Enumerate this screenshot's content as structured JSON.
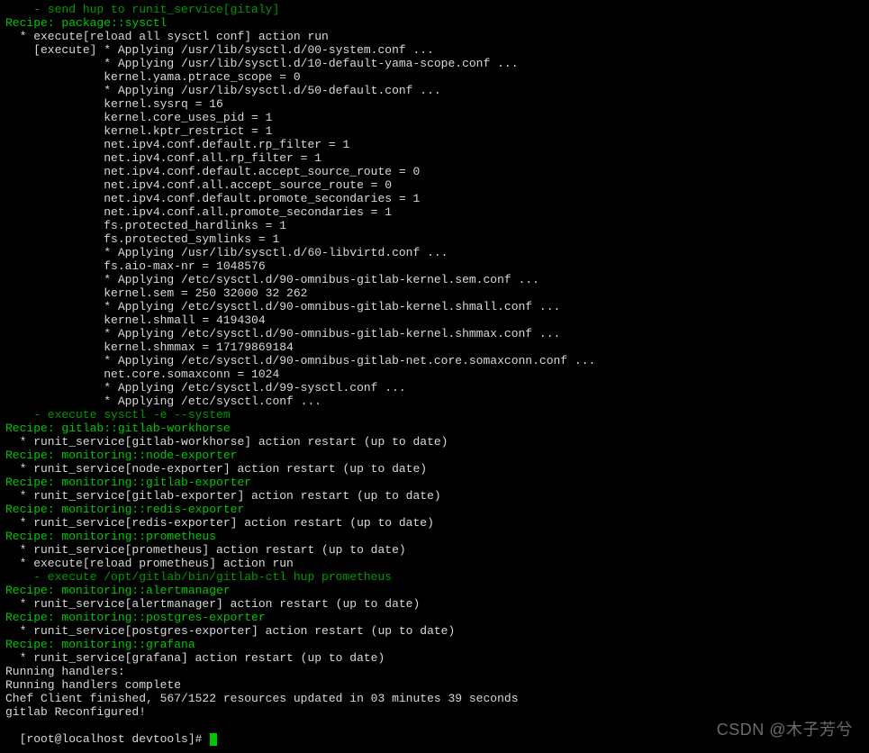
{
  "lines": [
    {
      "cls": "dimgreen",
      "text": "    - send hup to runit_service[gitaly]"
    },
    {
      "cls": "green",
      "text": "Recipe: package::sysctl"
    },
    {
      "cls": "",
      "text": "  * execute[reload all sysctl conf] action run"
    },
    {
      "cls": "",
      "text": "    [execute] * Applying /usr/lib/sysctl.d/00-system.conf ..."
    },
    {
      "cls": "",
      "text": "              * Applying /usr/lib/sysctl.d/10-default-yama-scope.conf ..."
    },
    {
      "cls": "",
      "text": "              kernel.yama.ptrace_scope = 0"
    },
    {
      "cls": "",
      "text": "              * Applying /usr/lib/sysctl.d/50-default.conf ..."
    },
    {
      "cls": "",
      "text": "              kernel.sysrq = 16"
    },
    {
      "cls": "",
      "text": "              kernel.core_uses_pid = 1"
    },
    {
      "cls": "",
      "text": "              kernel.kptr_restrict = 1"
    },
    {
      "cls": "",
      "text": "              net.ipv4.conf.default.rp_filter = 1"
    },
    {
      "cls": "",
      "text": "              net.ipv4.conf.all.rp_filter = 1"
    },
    {
      "cls": "",
      "text": "              net.ipv4.conf.default.accept_source_route = 0"
    },
    {
      "cls": "",
      "text": "              net.ipv4.conf.all.accept_source_route = 0"
    },
    {
      "cls": "",
      "text": "              net.ipv4.conf.default.promote_secondaries = 1"
    },
    {
      "cls": "",
      "text": "              net.ipv4.conf.all.promote_secondaries = 1"
    },
    {
      "cls": "",
      "text": "              fs.protected_hardlinks = 1"
    },
    {
      "cls": "",
      "text": "              fs.protected_symlinks = 1"
    },
    {
      "cls": "",
      "text": "              * Applying /usr/lib/sysctl.d/60-libvirtd.conf ..."
    },
    {
      "cls": "",
      "text": "              fs.aio-max-nr = 1048576"
    },
    {
      "cls": "",
      "text": "              * Applying /etc/sysctl.d/90-omnibus-gitlab-kernel.sem.conf ..."
    },
    {
      "cls": "",
      "text": "              kernel.sem = 250 32000 32 262"
    },
    {
      "cls": "",
      "text": "              * Applying /etc/sysctl.d/90-omnibus-gitlab-kernel.shmall.conf ..."
    },
    {
      "cls": "",
      "text": "              kernel.shmall = 4194304"
    },
    {
      "cls": "",
      "text": "              * Applying /etc/sysctl.d/90-omnibus-gitlab-kernel.shmmax.conf ..."
    },
    {
      "cls": "",
      "text": "              kernel.shmmax = 17179869184"
    },
    {
      "cls": "",
      "text": "              * Applying /etc/sysctl.d/90-omnibus-gitlab-net.core.somaxconn.conf ..."
    },
    {
      "cls": "",
      "text": "              net.core.somaxconn = 1024"
    },
    {
      "cls": "",
      "text": "              * Applying /etc/sysctl.d/99-sysctl.conf ..."
    },
    {
      "cls": "",
      "text": "              * Applying /etc/sysctl.conf ..."
    },
    {
      "cls": "dimgreen",
      "text": "    - execute sysctl -e --system"
    },
    {
      "cls": "green",
      "text": "Recipe: gitlab::gitlab-workhorse"
    },
    {
      "cls": "",
      "text": "  * runit_service[gitlab-workhorse] action restart (up to date)"
    },
    {
      "cls": "green",
      "text": "Recipe: monitoring::node-exporter"
    },
    {
      "cls": "",
      "text": "  * runit_service[node-exporter] action restart (up to date)"
    },
    {
      "cls": "green",
      "text": "Recipe: monitoring::gitlab-exporter"
    },
    {
      "cls": "",
      "text": "  * runit_service[gitlab-exporter] action restart (up to date)"
    },
    {
      "cls": "green",
      "text": "Recipe: monitoring::redis-exporter"
    },
    {
      "cls": "",
      "text": "  * runit_service[redis-exporter] action restart (up to date)"
    },
    {
      "cls": "green",
      "text": "Recipe: monitoring::prometheus"
    },
    {
      "cls": "",
      "text": "  * runit_service[prometheus] action restart (up to date)"
    },
    {
      "cls": "",
      "text": "  * execute[reload prometheus] action run"
    },
    {
      "cls": "dimgreen",
      "text": "    - execute /opt/gitlab/bin/gitlab-ctl hup prometheus"
    },
    {
      "cls": "green",
      "text": "Recipe: monitoring::alertmanager"
    },
    {
      "cls": "",
      "text": "  * runit_service[alertmanager] action restart (up to date)"
    },
    {
      "cls": "green",
      "text": "Recipe: monitoring::postgres-exporter"
    },
    {
      "cls": "",
      "text": "  * runit_service[postgres-exporter] action restart (up to date)"
    },
    {
      "cls": "green",
      "text": "Recipe: monitoring::grafana"
    },
    {
      "cls": "",
      "text": "  * runit_service[grafana] action restart (up to date)"
    },
    {
      "cls": "",
      "text": ""
    },
    {
      "cls": "",
      "text": "Running handlers:"
    },
    {
      "cls": "",
      "text": "Running handlers complete"
    },
    {
      "cls": "",
      "text": "Chef Client finished, 567/1522 resources updated in 03 minutes 39 seconds"
    },
    {
      "cls": "",
      "text": "gitlab Reconfigured!"
    }
  ],
  "prompt": "[root@localhost devtools]# ",
  "watermark": "CSDN @木子芳兮"
}
